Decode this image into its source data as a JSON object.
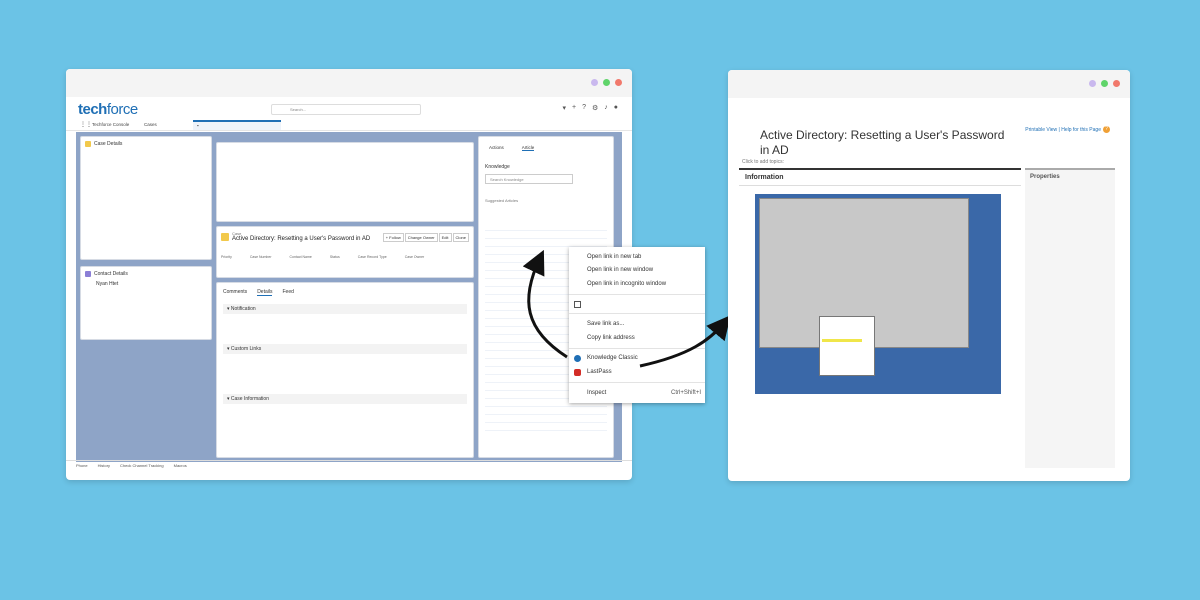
{
  "left_window": {
    "logo_tech": "tech",
    "logo_force": "force",
    "app_name": "Techforce Console",
    "nav_cases": "Cases",
    "search_placeholder": "Search...",
    "case_details_title": "Case Details",
    "contact_details_title": "Contact Details",
    "contact_name": "Nyan Htet",
    "case_label": "Case",
    "case_title": "Active Directory: Resetting a User's Password in AD",
    "case_actions": [
      "+ Follow",
      "Change Owner",
      "Edit",
      "Clone"
    ],
    "case_fields": [
      "Priority",
      "Case Number",
      "Contact Name",
      "Status",
      "Case Record Type",
      "Case Owner"
    ],
    "tabs": [
      "Comments",
      "Details",
      "Feed"
    ],
    "sections": [
      "Notification",
      "Custom Links",
      "Case Information"
    ],
    "right_tabs": [
      "Actions",
      "Article"
    ],
    "knowledge_title": "Knowledge",
    "knowledge_search_placeholder": "Search Knowledge",
    "suggested": "Suggested Articles",
    "bottom_bar": [
      "Phone",
      "History",
      "Check Channel Tracking",
      "Macros"
    ]
  },
  "context_menu": {
    "items": [
      {
        "label": "Open link in new tab"
      },
      {
        "label": "Open link in new window"
      },
      {
        "label": "Open link in incognito window"
      },
      {
        "label": "Save link as..."
      },
      {
        "label": "Copy link address"
      },
      {
        "label": "Knowledge Classic",
        "icon_color": "#1f6fb5"
      },
      {
        "label": "LastPass",
        "icon_color": "#d32d27"
      },
      {
        "label": "Inspect",
        "shortcut": "Ctrl+Shift+I"
      }
    ]
  },
  "right_window": {
    "article_title": "Active Directory: Resetting a User's Password in AD",
    "printable_link": "Printable View | Help for this Page",
    "click_topics": "Click to add topics:",
    "information_label": "Information",
    "properties_label": "Properties"
  },
  "colors": {
    "background": "#6bc3e6",
    "accent": "#1f6fb5"
  }
}
